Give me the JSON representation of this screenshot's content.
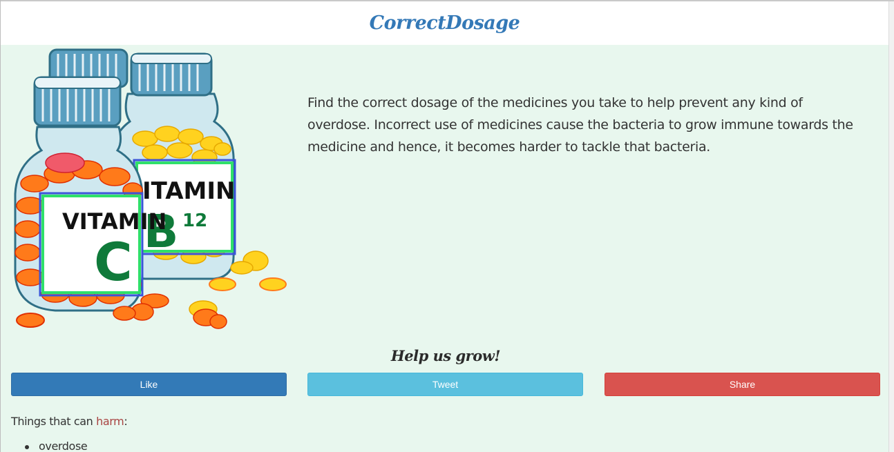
{
  "header": {
    "brand": "CorrectDosage"
  },
  "hero": {
    "bottle_left_label_top": "VITAMIN",
    "bottle_left_label_letter": "C",
    "bottle_right_label_top": "ITAMIN",
    "bottle_right_label_letter": "B",
    "bottle_right_label_sub": "12"
  },
  "intro": {
    "text": "Find the correct dosage of the medicines you take to help prevent any kind of overdose. Incorrect use of medicines cause the bacteria to grow immune towards the medicine and hence, it becomes harder to tackle that bacteria."
  },
  "social": {
    "heading": "Help us grow!",
    "like_label": "Like",
    "tweet_label": "Tweet",
    "share_label": "Share"
  },
  "harm": {
    "prefix": "Things that can ",
    "highlight": "harm",
    "suffix": ":",
    "items": [
      "overdose"
    ]
  },
  "colors": {
    "brand": "#3479b7",
    "page_bg": "#e8f7ee",
    "like": "#337ab7",
    "tweet": "#5bc0de",
    "share": "#d9534f",
    "harm_highlight": "#a94442"
  }
}
